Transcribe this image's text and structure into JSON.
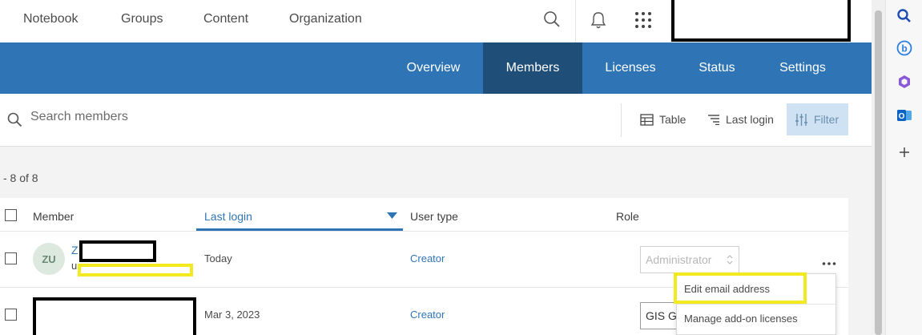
{
  "top_nav": {
    "tabs": [
      "Notebook",
      "Groups",
      "Content",
      "Organization"
    ],
    "active_tab": "Organization",
    "icons": [
      "search-icon",
      "bell-icon",
      "app-launcher-icon"
    ]
  },
  "sub_nav": {
    "items": [
      "Overview",
      "Members",
      "Licenses",
      "Status",
      "Settings"
    ],
    "active": "Members"
  },
  "toolbar": {
    "search_placeholder": "Search members",
    "table_label": "Table",
    "sort_label": "Last login",
    "filter_label": "Filter"
  },
  "members": {
    "count_text": "- 8 of 8",
    "columns": [
      "Member",
      "Last login",
      "User type",
      "Role"
    ],
    "sorted_column": "Last login",
    "rows": [
      {
        "avatar": "ZU",
        "name_fragment": "Z",
        "sub_fragment": "u",
        "last_login": "Today",
        "user_type": "Creator",
        "role": "Administrator"
      },
      {
        "last_login": "Mar 3, 2023",
        "user_type": "Creator",
        "role": "GIS G"
      }
    ]
  },
  "row_menu": {
    "more_icon": "more-horizontal-icon",
    "items": [
      "Edit email address",
      "Manage add-on licenses"
    ]
  },
  "colors": {
    "brand_blue": "#2f75b5",
    "active_subnav": "#1f4e79",
    "highlight_yellow": "#f2ea1f"
  }
}
